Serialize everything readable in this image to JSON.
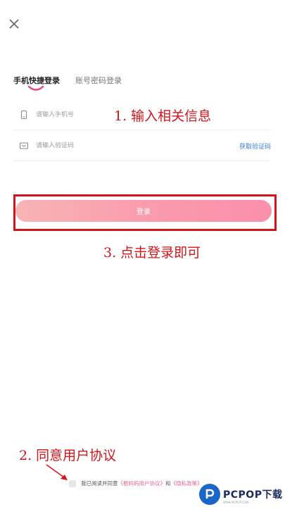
{
  "tabs": [
    {
      "label": "手机快捷登录",
      "active": true
    },
    {
      "label": "账号密码登录",
      "active": false
    }
  ],
  "phone": {
    "placeholder": "请输入手机号",
    "value": ""
  },
  "code": {
    "placeholder": "请输入验证码",
    "value": "",
    "get_code_label": "获取验证码"
  },
  "login_label": "登录",
  "agreement": {
    "prefix": "我已阅读并同意",
    "user_agreement": "《憨妈妈用户协议》",
    "and": "和",
    "privacy": "《隐私政策》",
    "checked": false
  },
  "annotations": {
    "step1": "1. 输入相关信息",
    "step2": "2. 同意用户协议",
    "step3": "3. 点击登录即可"
  },
  "watermark": {
    "text": "PCPOP下载",
    "sub": "WWW.PCPOP.COM"
  },
  "colors": {
    "accent_pink": "#fa9aae",
    "annotation_red": "#d4141a",
    "link_blue": "#3b7fd8"
  }
}
